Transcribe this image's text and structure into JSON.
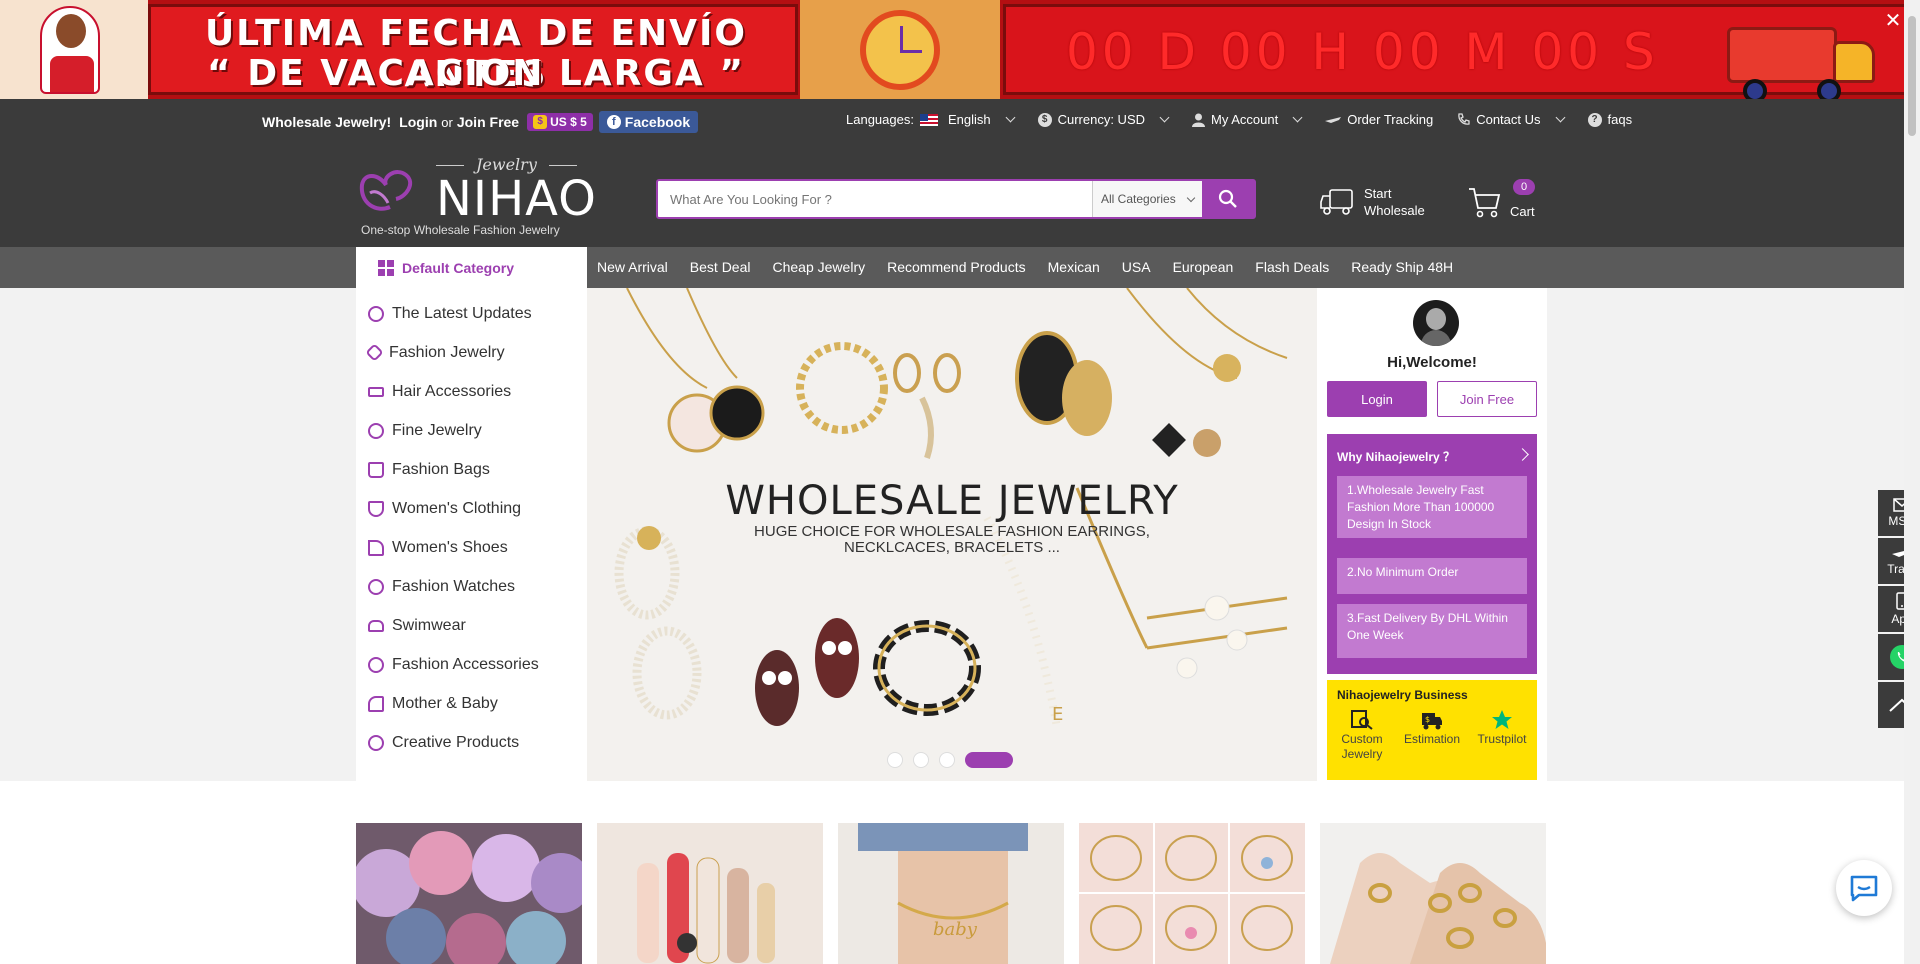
{
  "promo": {
    "line1": "ÚLTIMA FECHA DE ENVÍO ANTES",
    "line2": "“ DE VACACION LARGA ”",
    "countdown": "00 D 00 H 00 M 00 S",
    "close": "✕"
  },
  "topbar": {
    "wholesale": "Wholesale Jewelry!",
    "login": "Login",
    "or": "or",
    "join": "Join Free",
    "coupon": "US $ 5",
    "facebook": "Facebook",
    "languages_label": "Languages:",
    "language": "English",
    "currency": "Currency: USD",
    "account": "My Account",
    "tracking": "Order Tracking",
    "contact": "Contact Us",
    "faqs": "faqs"
  },
  "header": {
    "logo_jewelry": "Jewelry",
    "logo_name": "NIHAO",
    "logo_tagline": "One-stop Wholesale Fashion Jewelry",
    "search_placeholder": "What Are You Looking For ?",
    "category_select": "All Categories",
    "start_wholesale_1": "Start",
    "start_wholesale_2": "Wholesale",
    "cart_label": "Cart",
    "cart_count": "0"
  },
  "nav": {
    "default_category": "Default Category",
    "links": [
      "New Arrival",
      "Best Deal",
      "Cheap Jewelry",
      "Recommend Products",
      "Mexican",
      "USA",
      "European",
      "Flash Deals",
      "Ready Ship 48H"
    ]
  },
  "categories": [
    "The Latest Updates",
    "Fashion Jewelry",
    "Hair Accessories",
    "Fine Jewelry",
    "Fashion Bags",
    "Women's Clothing",
    "Women's Shoes",
    "Fashion Watches",
    "Swimwear",
    "Fashion Accessories",
    "Mother & Baby",
    "Creative Products"
  ],
  "hero": {
    "title": "WHOLESALE JEWELRY",
    "subtitle_1": "HUGE CHOICE FOR WHOLESALE FASHION EARRINGS,",
    "subtitle_2": "NECKLCACES, BRACELETS ...",
    "active_slide": 4,
    "slide_count": 4
  },
  "welcome": {
    "greeting": "Hi,Welcome!",
    "login": "Login",
    "join": "Join Free",
    "why_title": "Why Nihaojewelry ？",
    "points": [
      "1.Wholesale Jewelry Fast Fashion More Than 100000 Design In Stock",
      "2.No Minimum Order",
      "3.Fast Delivery By DHL Within One Week"
    ],
    "business_title": "Nihaojewelry Business",
    "business_items": [
      "Custom Jewelry",
      "Estimation",
      "Trustpilot"
    ]
  },
  "side_tools": [
    "MSG",
    "Track",
    "App"
  ],
  "colors": {
    "brand_purple": "#9c3fb0",
    "dark_bar": "#3b3b3b",
    "nav_bar": "#5a5a5a",
    "promo_red": "#e01b1f",
    "business_yellow": "#ffe100",
    "whatsapp_green": "#25d366"
  }
}
